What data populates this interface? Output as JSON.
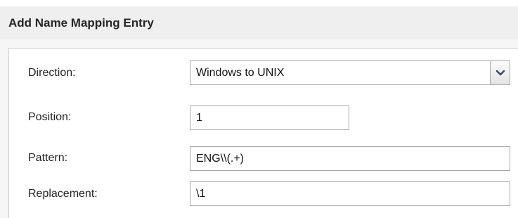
{
  "dialog": {
    "title": "Add Name Mapping Entry"
  },
  "form": {
    "direction": {
      "label": "Direction:",
      "value": "Windows to UNIX",
      "icon": "chevron-down-icon"
    },
    "position": {
      "label": "Position:",
      "value": "1"
    },
    "pattern": {
      "label": "Pattern:",
      "value": "ENG\\\\(.+)"
    },
    "replacement": {
      "label": "Replacement:",
      "value": "\\1"
    }
  },
  "colors": {
    "header_bg": "#efefef",
    "border": "#a9a9a9",
    "chevron": "#2e4a6b"
  }
}
